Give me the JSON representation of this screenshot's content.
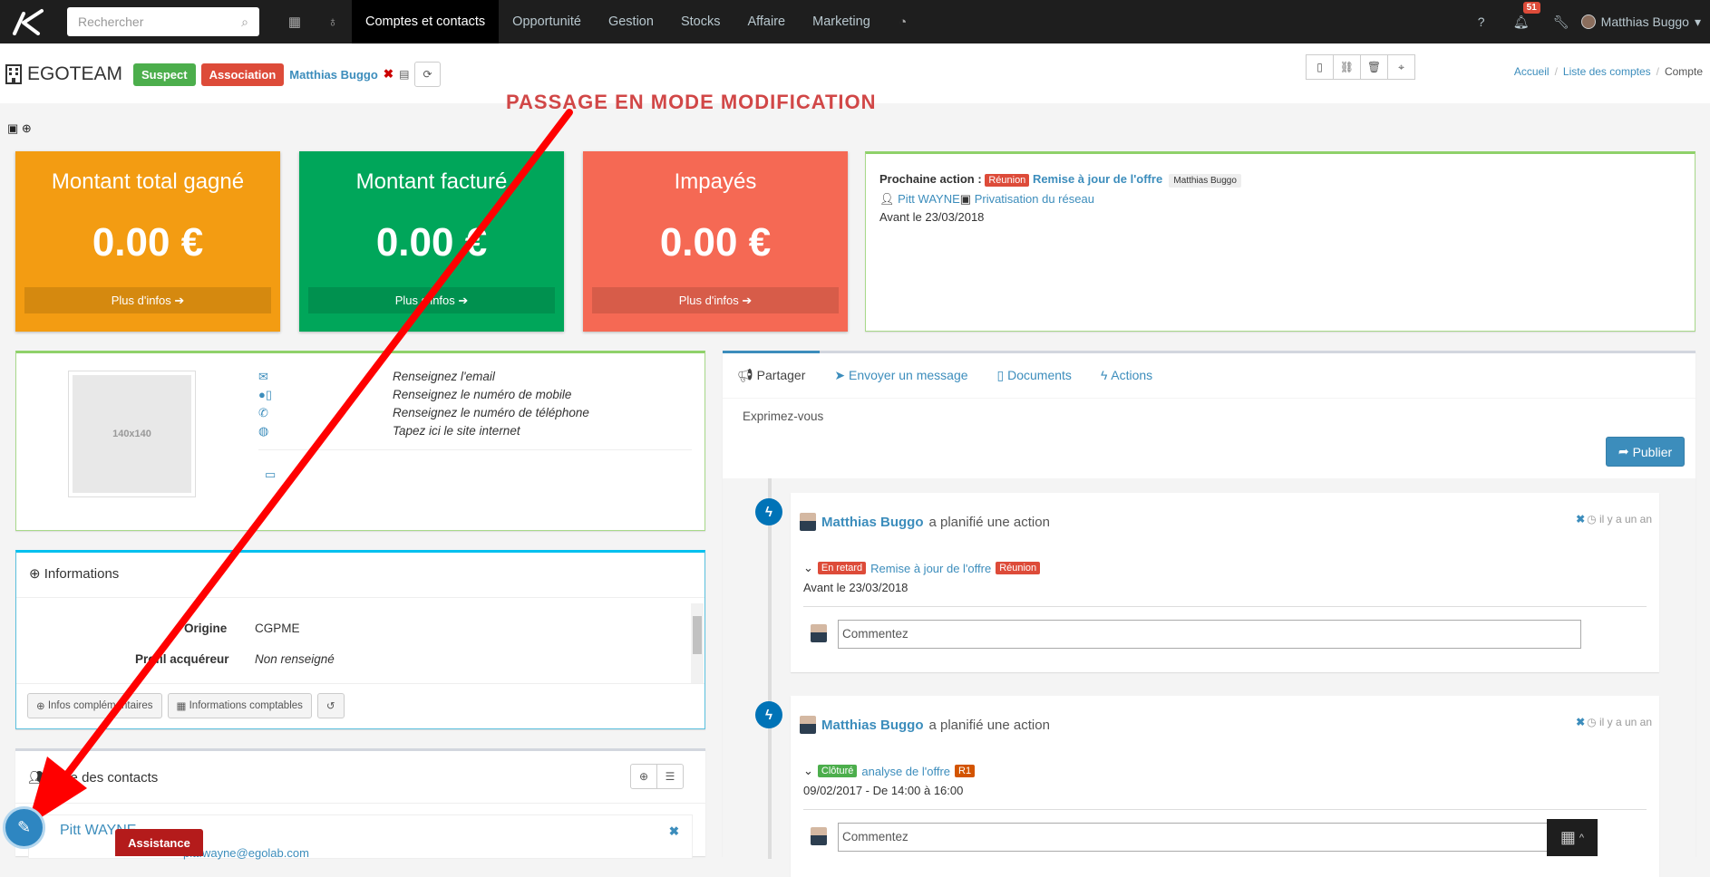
{
  "topbar": {
    "search_placeholder": "Rechercher",
    "nav": [
      "Comptes et contacts",
      "Opportunité",
      "Gestion",
      "Stocks",
      "Affaire",
      "Marketing"
    ],
    "notif_count": "51",
    "user": "Matthias Buggo"
  },
  "header": {
    "account": "EGOTEAM",
    "status_label": "Suspect",
    "type_label": "Association",
    "owner": "Matthias Buggo",
    "breadcrumb": [
      "Accueil",
      "Liste des comptes",
      "Compte"
    ]
  },
  "annotation": "PASSAGE EN MODE MODIFICATION",
  "tiles": [
    {
      "title": "Montant total gagné",
      "value": "0.00 €",
      "more": "Plus d'infos"
    },
    {
      "title": "Montant facturé",
      "value": "0.00 €",
      "more": "Plus d'infos"
    },
    {
      "title": "Impayés",
      "value": "0.00 €",
      "more": "Plus d'infos"
    }
  ],
  "next_action": {
    "label": "Prochaine action :",
    "tag": "Réunion",
    "title": "Remise à jour de l'offre",
    "owner": "Matthias Buggo",
    "contact": "Pitt WAYNE",
    "project": "Privatisation du réseau",
    "due": "Avant le 23/03/2018"
  },
  "contact": {
    "photo_placeholder": "140x140",
    "email": "Renseignez l'email",
    "mobile": "Renseignez le numéro de mobile",
    "phone": "Renseignez le numéro de téléphone",
    "website": "Tapez ici le site internet"
  },
  "informations": {
    "title": "Informations",
    "rows": [
      {
        "label": "Origine",
        "value": "CGPME"
      },
      {
        "label": "Profil acquéreur",
        "value": "Non renseigné"
      }
    ],
    "buttons": [
      "Infos complémentaires",
      "Informations comptables"
    ]
  },
  "contacts_list": {
    "title": "Liste des contacts",
    "first_contact": "Pitt WAYNE",
    "first_email": "pitt.wayne@egolab.com"
  },
  "wall": {
    "tabs": [
      "Partager",
      "Envoyer un message",
      "Documents",
      "Actions"
    ],
    "placeholder": "Exprimez-vous",
    "publish": "Publier",
    "items": [
      {
        "author": "Matthias Buggo",
        "text": "a planifié une action",
        "time": "il y a un an",
        "status": "En retard",
        "title": "Remise à jour de l'offre",
        "tag": "Réunion",
        "date": "Avant le 23/03/2018",
        "comment": "Commentez"
      },
      {
        "author": "Matthias Buggo",
        "text": "a planifié une action",
        "time": "il y a un an",
        "status": "Clôturé",
        "title": "analyse de l'offre",
        "tag": "R1",
        "date": "09/02/2017 - De 14:00 à 16:00",
        "comment": "Commentez"
      }
    ]
  },
  "assistance": "Assistance"
}
